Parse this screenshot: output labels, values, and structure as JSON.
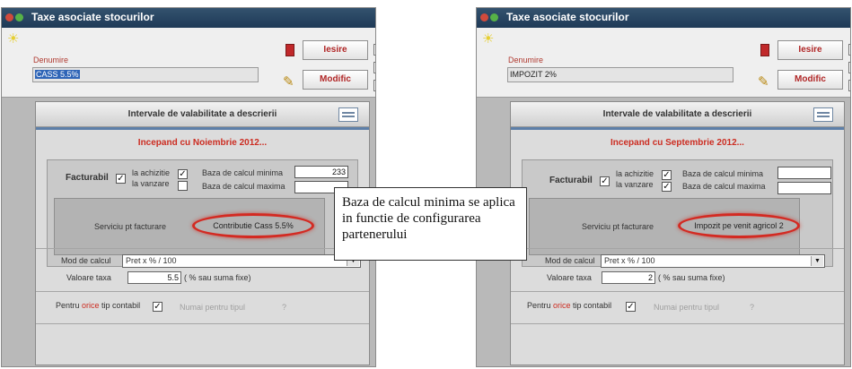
{
  "windows": [
    {
      "title": "Taxe asociate stocurilor",
      "denumire_label": "Denumire",
      "denumire_value": "CASS 5.5%",
      "iesire_label": "Iesire",
      "modific_label": "Modific",
      "panel_title": "Intervale de valabilitate a descrierii",
      "period": "Incepand cu Noiembrie 2012...",
      "facturabil_label": "Facturabil",
      "la_achizitie": "la achizitie",
      "la_vanzare": "la vanzare",
      "baza_minima_label": "Baza de calcul minima",
      "baza_minima_value": "233",
      "baza_maxima_label": "Baza de calcul maxima",
      "baza_maxima_value": "",
      "serviciu_label": "Serviciu pt facturare",
      "serviciu_value": "Contributie Cass 5.5%",
      "mod_calcul_label": "Mod de calcul",
      "mod_calcul_value": "Pret x % / 100",
      "valoare_taxa_label": "Valoare taxa",
      "valoare_taxa_value": "5.5",
      "valoare_hint": "( % sau suma fixe)",
      "pentru_prefix": "Pentru ",
      "pentru_highlight": "orice",
      "pentru_suffix": " tip contabil",
      "numai_label": "Numai pentru tipul",
      "question": "?",
      "check_mark": "✓"
    },
    {
      "title": "Taxe asociate stocurilor",
      "denumire_label": "Denumire",
      "denumire_value": "IMPOZIT 2%",
      "iesire_label": "Iesire",
      "modific_label": "Modific",
      "panel_title": "Intervale de valabilitate a descrierii",
      "period": "Incepand cu Septembrie 2012...",
      "facturabil_label": "Facturabil",
      "la_achizitie": "la achizitie",
      "la_vanzare": "la vanzare",
      "baza_minima_label": "Baza de calcul minima",
      "baza_minima_value": "",
      "baza_maxima_label": "Baza de calcul maxima",
      "baza_maxima_value": "",
      "serviciu_label": "Serviciu pt facturare",
      "serviciu_value": "Impozit pe venit agricol 2",
      "mod_calcul_label": "Mod de calcul",
      "mod_calcul_value": "Pret x % / 100",
      "valoare_taxa_label": "Valoare taxa",
      "valoare_taxa_value": "2",
      "valoare_hint": "( % sau suma fixe)",
      "pentru_prefix": "Pentru ",
      "pentru_highlight": "orice",
      "pentru_suffix": " tip contabil",
      "numai_label": "Numai pentru tipul",
      "question": "?",
      "check_mark": "✓"
    }
  ],
  "callout": {
    "text": "Baza de calcul minima se aplica in functie de configurarea partenerului"
  },
  "icons": {
    "bulb": "lightbulb-icon",
    "exit": "exit-door-icon",
    "edit": "pencil-edit-icon",
    "notepad": "notepad-edit-icon"
  },
  "colors": {
    "titlebar": "#1f3a57",
    "accent_red": "#cc2d22",
    "highlight_blue": "#2f65b7"
  }
}
